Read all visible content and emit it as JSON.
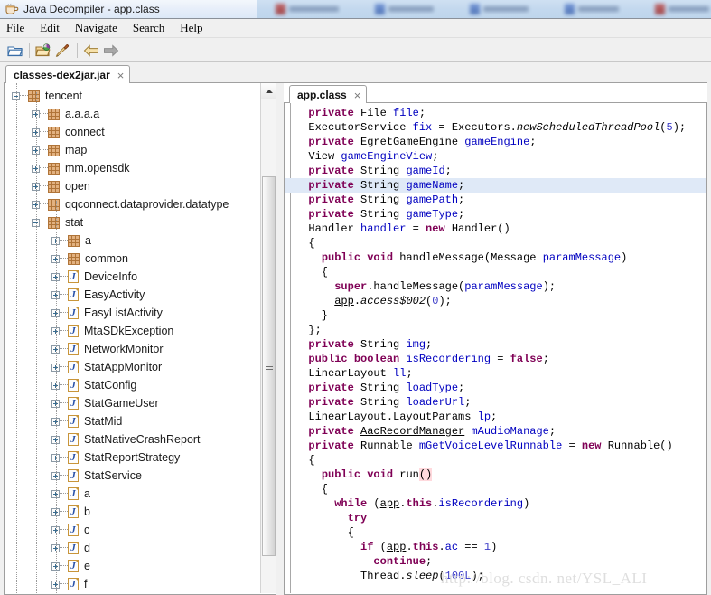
{
  "window": {
    "title": "Java Decompiler - app.class",
    "app_icon": "coffee-cup-icon"
  },
  "menubar": {
    "items": [
      {
        "label": "File",
        "mnemonic": "F"
      },
      {
        "label": "Edit",
        "mnemonic": "E"
      },
      {
        "label": "Navigate",
        "mnemonic": "N"
      },
      {
        "label": "Search",
        "mnemonic": "a"
      },
      {
        "label": "Help",
        "mnemonic": "H"
      }
    ]
  },
  "toolbar": {
    "buttons": [
      {
        "name": "open-file-icon",
        "tooltip": "Open File"
      },
      {
        "name": "open-type-icon",
        "tooltip": "Open Type"
      },
      {
        "name": "save-source-icon",
        "tooltip": "Save Source"
      },
      {
        "name": "back-arrow-icon",
        "tooltip": "Back"
      },
      {
        "name": "forward-arrow-icon",
        "tooltip": "Forward"
      }
    ]
  },
  "jar_tab": {
    "label": "classes-dex2jar.jar",
    "close": "×"
  },
  "class_tab": {
    "label": "app.class",
    "close": "×"
  },
  "tree": {
    "nodes": [
      {
        "label": "tencent",
        "type": "package",
        "state": "expanded",
        "depth": 0
      },
      {
        "label": "a.a.a.a",
        "type": "package",
        "state": "collapsed",
        "depth": 1
      },
      {
        "label": "connect",
        "type": "package",
        "state": "collapsed",
        "depth": 1
      },
      {
        "label": "map",
        "type": "package",
        "state": "collapsed",
        "depth": 1
      },
      {
        "label": "mm.opensdk",
        "type": "package",
        "state": "collapsed",
        "depth": 1
      },
      {
        "label": "open",
        "type": "package",
        "state": "collapsed",
        "depth": 1
      },
      {
        "label": "qqconnect.dataprovider.datatype",
        "type": "package",
        "state": "collapsed",
        "depth": 1
      },
      {
        "label": "stat",
        "type": "package",
        "state": "expanded",
        "depth": 1
      },
      {
        "label": "a",
        "type": "package",
        "state": "collapsed",
        "depth": 2
      },
      {
        "label": "common",
        "type": "package",
        "state": "collapsed",
        "depth": 2
      },
      {
        "label": "DeviceInfo",
        "type": "class",
        "state": "collapsed",
        "depth": 2
      },
      {
        "label": "EasyActivity",
        "type": "class",
        "state": "collapsed",
        "depth": 2
      },
      {
        "label": "EasyListActivity",
        "type": "class",
        "state": "collapsed",
        "depth": 2
      },
      {
        "label": "MtaSDkException",
        "type": "class",
        "state": "collapsed",
        "depth": 2
      },
      {
        "label": "NetworkMonitor",
        "type": "class",
        "state": "collapsed",
        "depth": 2
      },
      {
        "label": "StatAppMonitor",
        "type": "class",
        "state": "collapsed",
        "depth": 2
      },
      {
        "label": "StatConfig",
        "type": "class",
        "state": "collapsed",
        "depth": 2
      },
      {
        "label": "StatGameUser",
        "type": "class",
        "state": "collapsed",
        "depth": 2
      },
      {
        "label": "StatMid",
        "type": "class",
        "state": "collapsed",
        "depth": 2
      },
      {
        "label": "StatNativeCrashReport",
        "type": "class",
        "state": "collapsed",
        "depth": 2
      },
      {
        "label": "StatReportStrategy",
        "type": "class",
        "state": "collapsed",
        "depth": 2
      },
      {
        "label": "StatService",
        "type": "class",
        "state": "collapsed",
        "depth": 2
      },
      {
        "label": "a",
        "type": "class",
        "state": "collapsed",
        "depth": 2
      },
      {
        "label": "b",
        "type": "class",
        "state": "collapsed",
        "depth": 2
      },
      {
        "label": "c",
        "type": "class",
        "state": "collapsed",
        "depth": 2
      },
      {
        "label": "d",
        "type": "class",
        "state": "collapsed",
        "depth": 2
      },
      {
        "label": "e",
        "type": "class",
        "state": "collapsed",
        "depth": 2
      },
      {
        "label": "f",
        "type": "class",
        "state": "collapsed",
        "depth": 2
      }
    ]
  },
  "code": {
    "highlighted_line_index": 5,
    "lines": [
      "  private File file;",
      "  ExecutorService fix = Executors.newScheduledThreadPool(5);",
      "  private EgretGameEngine gameEngine;",
      "  View gameEngineView;",
      "  private String gameId;",
      "  private String gameName;",
      "  private String gamePath;",
      "  private String gameType;",
      "  Handler handler = new Handler()",
      "  {",
      "    public void handleMessage(Message paramMessage)",
      "    {",
      "      super.handleMessage(paramMessage);",
      "      app.access$002(0);",
      "    }",
      "  };",
      "  private String img;",
      "  public boolean isRecordering = false;",
      "  LinearLayout ll;",
      "  private String loadType;",
      "  private String loaderUrl;",
      "  LinearLayout.LayoutParams lp;",
      "  private AacRecordManager mAudioManage;",
      "  private Runnable mGetVoiceLevelRunnable = new Runnable()",
      "  {",
      "    public void run()",
      "    {",
      "      while (app.this.isRecordering)",
      "        try",
      "        {",
      "          if (app.this.ac == 1)",
      "            continue;",
      "          Thread.sleep(100L);"
    ]
  },
  "watermark": {
    "text": "http://blog. csdn. net/YSL_ALI"
  },
  "colors": {
    "keyword": "#7f0055",
    "identifier": "#0000c0",
    "number": "#3c3cc8",
    "highlight_row": "#dfe9f7",
    "occurrence_highlight": "#ffd9dd",
    "package_icon": "#e2b180",
    "class_icon_letter": "#2750a8"
  }
}
